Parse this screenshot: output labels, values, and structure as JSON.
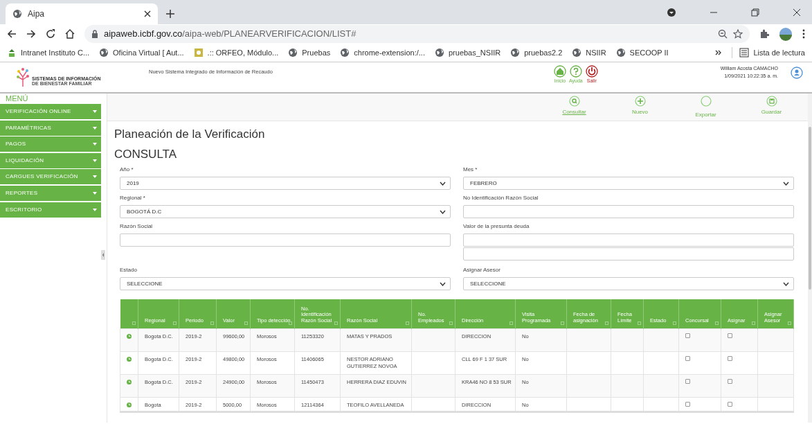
{
  "browser": {
    "tab_title": "Aipa",
    "url_host": "aipaweb.icbf.gov.co",
    "url_path": "/aipa-web/PLANEARVERIFICACION/LIST#",
    "bookmarks": [
      {
        "label": "Intranet Instituto C...",
        "kind": "logo"
      },
      {
        "label": "Oficina Virtual [ Aut...",
        "kind": "globe"
      },
      {
        "label": ".:: ORFEO, Módulo...",
        "kind": "badge"
      },
      {
        "label": "Pruebas",
        "kind": "globe"
      },
      {
        "label": "chrome-extension:/...",
        "kind": "globe"
      },
      {
        "label": "pruebas_NSIIR",
        "kind": "globe"
      },
      {
        "label": "pruebas2.2",
        "kind": "globe"
      },
      {
        "label": "NSIIR",
        "kind": "globe"
      },
      {
        "label": "SECOOP II",
        "kind": "globe"
      }
    ],
    "reading_list": "Lista de lectura"
  },
  "header": {
    "logo_title": "SISTEMAS DE INFORMACIÓN",
    "logo_subtitle": "DE BIENESTAR FAMILIAR",
    "system_name": "Nuevo Sistema Integrado de Información de Recaudo",
    "nav": [
      {
        "label": "Inicio",
        "kind": "home"
      },
      {
        "label": "Ayuda",
        "kind": "help"
      },
      {
        "label": "Salir",
        "kind": "exit"
      }
    ],
    "user": "William Acosta CAMACHO",
    "datetime": "1/09/2021 10:22:35 a. m."
  },
  "menu": {
    "title": "MENÚ",
    "items": [
      "VERIFICACIÓN ONLINE",
      "PARAMÉTRICAS",
      "PAGOS",
      "LIQUIDACIÓN",
      "CARGUES VERIFICACIÓN",
      "REPORTES",
      "ESCRITORIO"
    ]
  },
  "toolbar": [
    {
      "label": "Consultar",
      "kind": "search",
      "selected": true
    },
    {
      "label": "Nuevo",
      "kind": "add",
      "selected": false
    },
    {
      "label": "Exportar",
      "kind": "blank",
      "selected": false
    },
    {
      "label": "Guardar",
      "kind": "save",
      "selected": false
    }
  ],
  "page_title": "Planeación de la Verificación",
  "section_title": "CONSULTA",
  "form_rows": [
    [
      {
        "label": "Año *",
        "kind": "select",
        "value": "2019"
      },
      {
        "label": "Mes *",
        "kind": "select",
        "value": "FEBRERO"
      }
    ],
    [
      {
        "label": "Regional *",
        "kind": "select",
        "value": "BOGOTÁ D.C"
      },
      {
        "label": "No Identificación Razón Social",
        "kind": "text"
      }
    ],
    [
      {
        "label": "Razón Social",
        "kind": "text"
      },
      {
        "label": "Valor de la presunta deuda",
        "kind": "range"
      }
    ],
    [
      {
        "label": "Estado",
        "kind": "select",
        "value": "SELECCIONE"
      },
      {
        "label": "Asignar Asesor",
        "kind": "select",
        "value": "SELECCIONE"
      }
    ]
  ],
  "table": {
    "columns": [
      "",
      "Regional",
      "Periodo",
      "Valor",
      "Tipo detección",
      "No. Identificación Razón Social",
      "Razón Social",
      "No. Empleados",
      "Dirección",
      "Visita Programada",
      "Fecha de asignación",
      "Fecha Límite",
      "Estado",
      "Concursal",
      "Asignar",
      "Asignar Asesor"
    ],
    "rows": [
      {
        "regional": "Bogota D.C.",
        "periodo": "2019-2",
        "valor": "99600,00",
        "tipo": "Morosos",
        "identificacion": "11253320",
        "razon_social": "MATAS Y PRADOS",
        "direccion": "DIRECCION",
        "visita": "No",
        "concursal": false,
        "asignar": false
      },
      {
        "regional": "Bogota D.C.",
        "periodo": "2019-2",
        "valor": "49800,00",
        "tipo": "Morosos",
        "identificacion": "11406065",
        "razon_social": "NESTOR ADRIANO GUTIERREZ NOVOA",
        "direccion": "CLL 69 F 1 37 SUR",
        "visita": "No",
        "concursal": false,
        "asignar": false
      },
      {
        "regional": "Bogota D.C.",
        "periodo": "2019-2",
        "valor": "24900,00",
        "tipo": "Morosos",
        "identificacion": "11450473",
        "razon_social": "HERRERA DIAZ EDUVIN",
        "direccion": "KRA46 NO 8 53 SUR",
        "visita": "No",
        "concursal": false,
        "asignar": false
      },
      {
        "regional": "Bogota",
        "periodo": "2019-2",
        "valor": "5000,00",
        "tipo": "Morosos",
        "identificacion": "12114364",
        "razon_social": "TEOFILO AVELLANEDA",
        "direccion": "DIRECCION",
        "visita": "No",
        "concursal": false,
        "asignar": false
      }
    ]
  }
}
